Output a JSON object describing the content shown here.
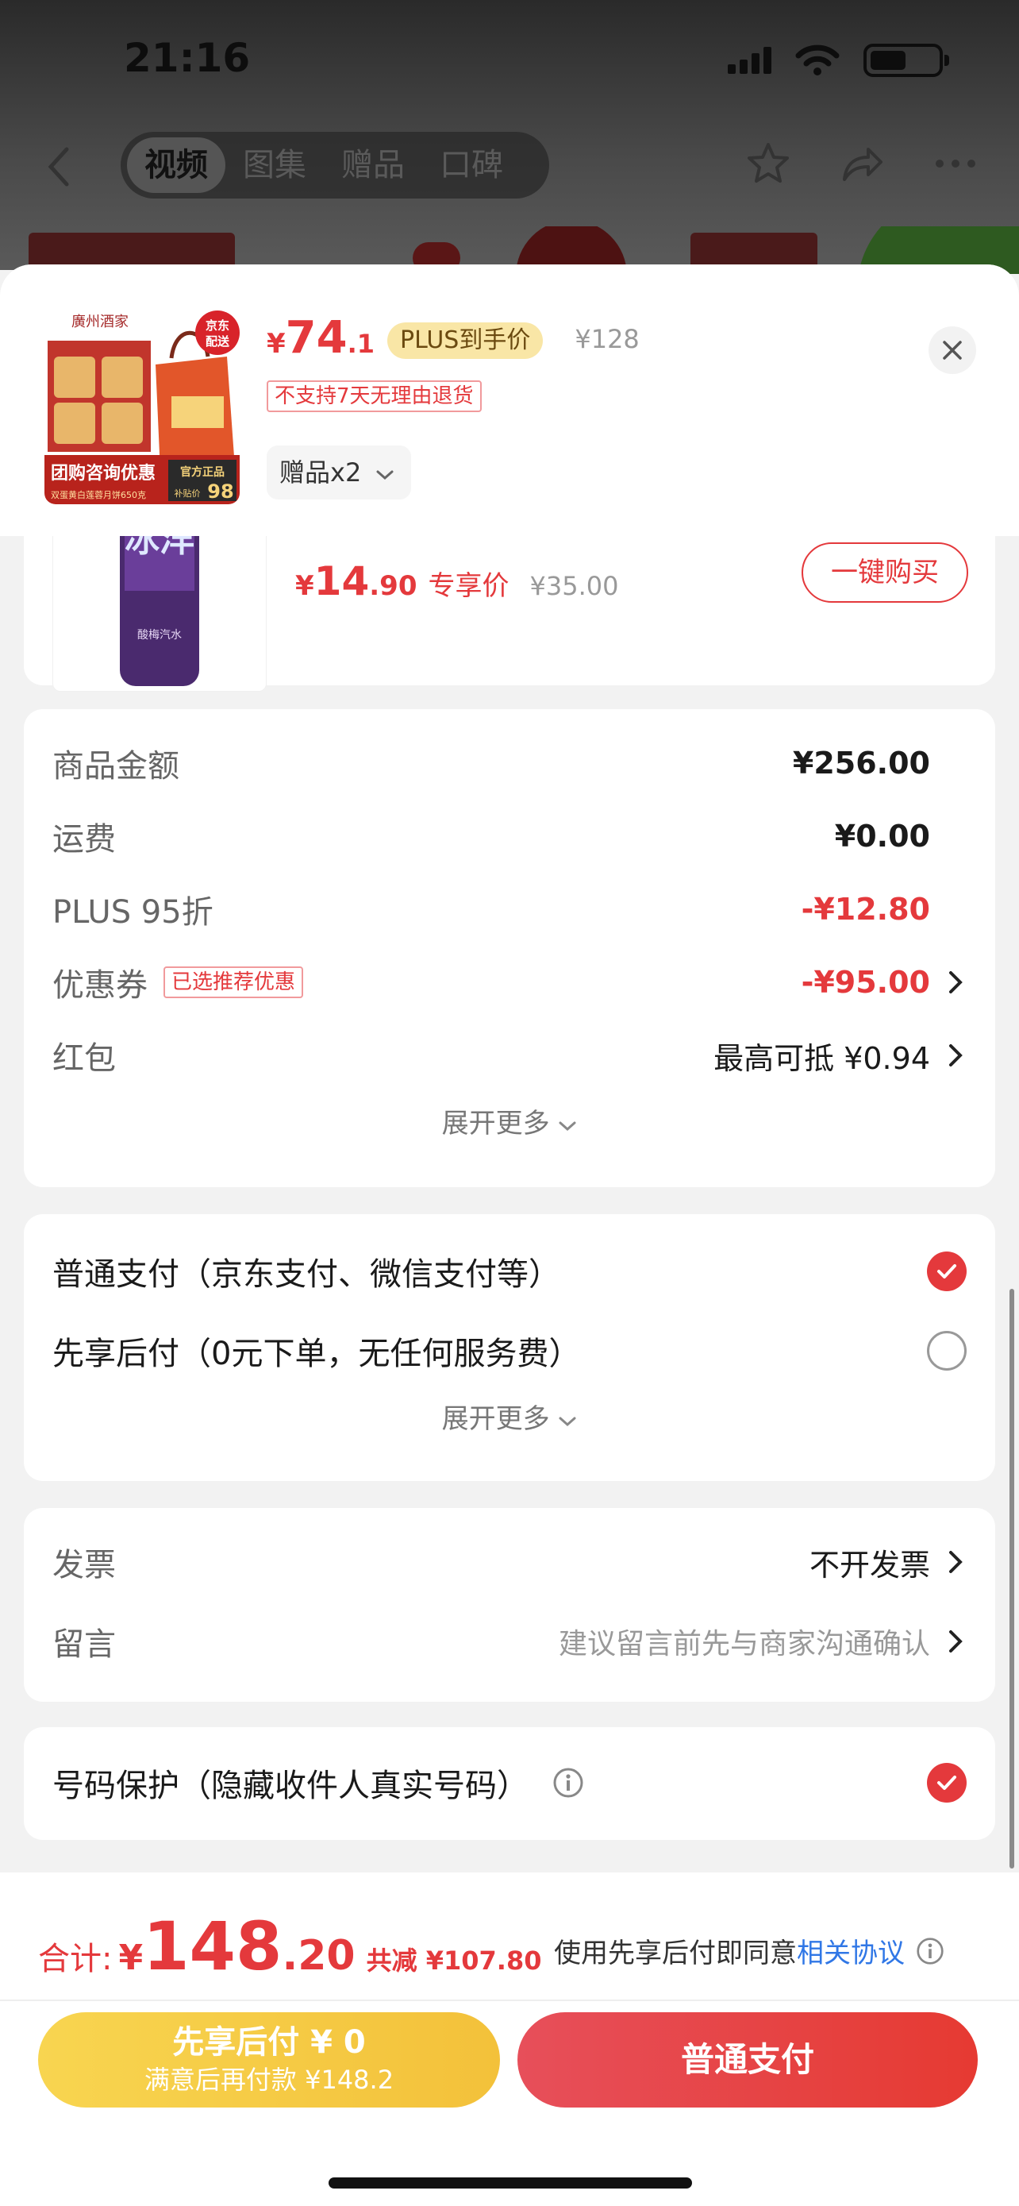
{
  "status_bar": {
    "time": "21:16"
  },
  "nav": {
    "tabs": [
      "视频",
      "图集",
      "赠品",
      "口碑"
    ],
    "active_tab": 0
  },
  "product": {
    "price_symbol": "¥",
    "price_int": "74",
    "price_dec": ".1",
    "plus_tag": "PLUS到手价",
    "original_price": "¥128",
    "no_return_tag": "不支持7天无理由退货",
    "gift_label": "赠品x2",
    "image_text": {
      "brand": "廣州酒家",
      "badge": "京东配送",
      "banner": "团购咨询优惠",
      "banner_sub": "双蛋黄白莲蓉月饼650克",
      "official": "官方正品",
      "official_price_label": "补贴价",
      "official_price": "98"
    }
  },
  "recommend": {
    "price_symbol": "¥",
    "price_int": "14",
    "price_dec": ".90",
    "price_label": "专享价",
    "original_price": "¥35.00",
    "buy_button": "一键购买",
    "image_text": {
      "brand": "冰洋",
      "sub": "酸梅汽水"
    }
  },
  "summary": {
    "rows": [
      {
        "label": "商品金额",
        "value": "¥256.00"
      },
      {
        "label": "运费",
        "value": "¥0.00"
      },
      {
        "label": "PLUS 95折",
        "value": "-¥12.80"
      },
      {
        "label": "优惠券",
        "tag": "已选推荐优惠",
        "value": "-¥95.00"
      },
      {
        "label": "红包",
        "value": "最高可抵 ¥0.94"
      }
    ],
    "expand": "展开更多"
  },
  "payment": {
    "options": [
      {
        "label": "普通支付（京东支付、微信支付等）",
        "checked": true
      },
      {
        "label": "先享后付（0元下单，无任何服务费）",
        "checked": false
      }
    ],
    "expand": "展开更多"
  },
  "invoice": {
    "rows": [
      {
        "label": "发票",
        "value": "不开发票"
      },
      {
        "label": "留言",
        "value": "建议留言前先与商家沟通确认"
      }
    ]
  },
  "privacy": {
    "label": "号码保护（隐藏收件人真实号码）",
    "checked": true
  },
  "footer": {
    "total_label": "合计:",
    "total_symbol": "¥",
    "total_int": "148",
    "total_dec": ".20",
    "saved": "共减 ¥107.80",
    "agree_text": "使用先享后付即同意",
    "agree_link": "相关协议",
    "later_line1": "先享后付 ¥ 0",
    "later_line2": "满意后再付款 ¥148.2",
    "pay_button": "普通支付"
  },
  "colors": {
    "accent_red": "#e4393c",
    "link_blue": "#3077e6",
    "plus_gold": "#f9e6a6"
  }
}
